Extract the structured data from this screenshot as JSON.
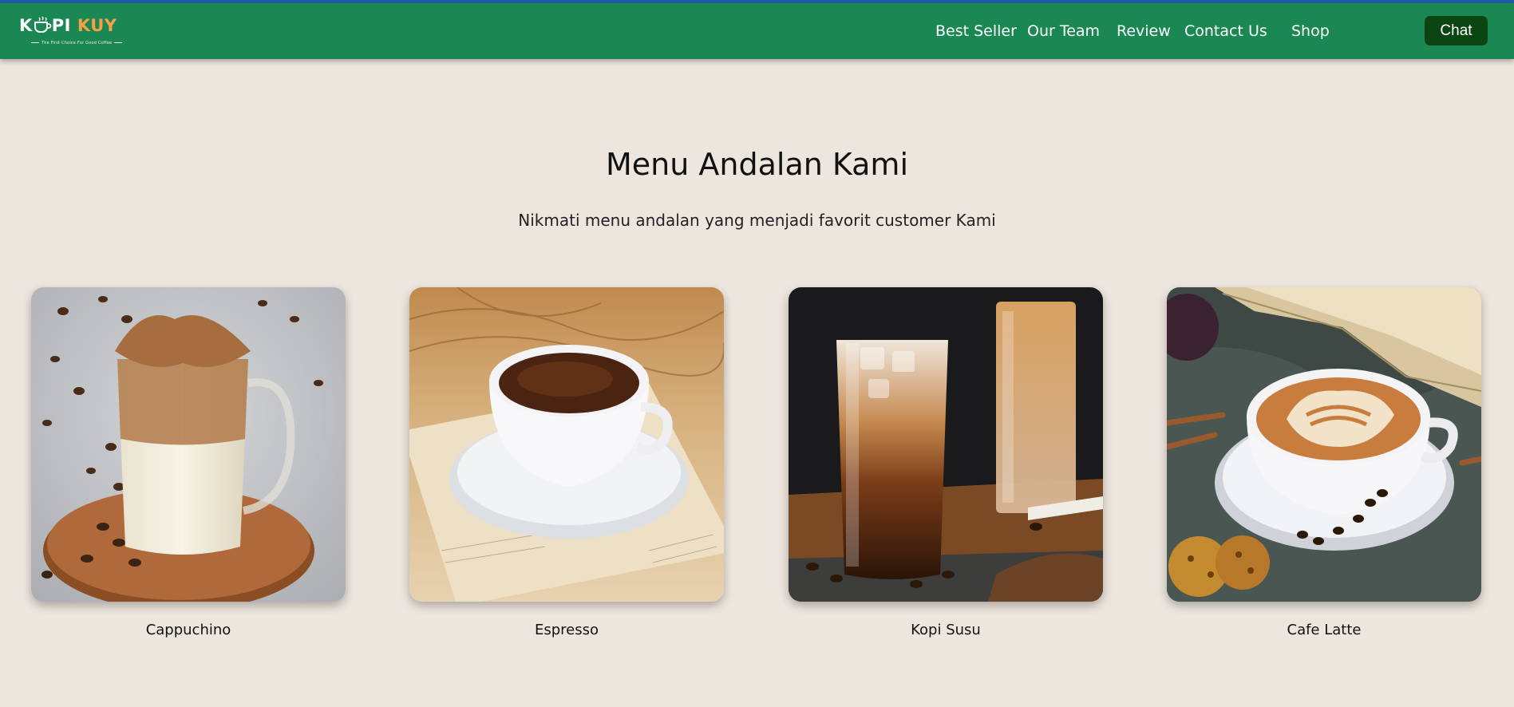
{
  "brand": {
    "name_part1": "K",
    "name_part2": "PI",
    "name_part3": "KUY",
    "tagline": "The First Choice For Good Coffee"
  },
  "nav": {
    "items": [
      {
        "label": "Best Seller"
      },
      {
        "label": "Our Team"
      },
      {
        "label": "Review"
      },
      {
        "label": "Contact Us"
      },
      {
        "label": "Shop"
      }
    ],
    "chat_label": "Chat"
  },
  "section": {
    "title": "Menu Andalan Kami",
    "subtitle": "Nikmati menu andalan yang menjadi favorit customer Kami"
  },
  "menu": [
    {
      "name": "Cappuchino"
    },
    {
      "name": "Espresso"
    },
    {
      "name": "Kopi Susu"
    },
    {
      "name": "Cafe Latte"
    }
  ],
  "colors": {
    "navbar": "#1b8753",
    "top_line": "#1f5aa8",
    "page_background": "#ede6de",
    "chat_button": "#0a4512",
    "logo_accent": "#f5a04a"
  }
}
